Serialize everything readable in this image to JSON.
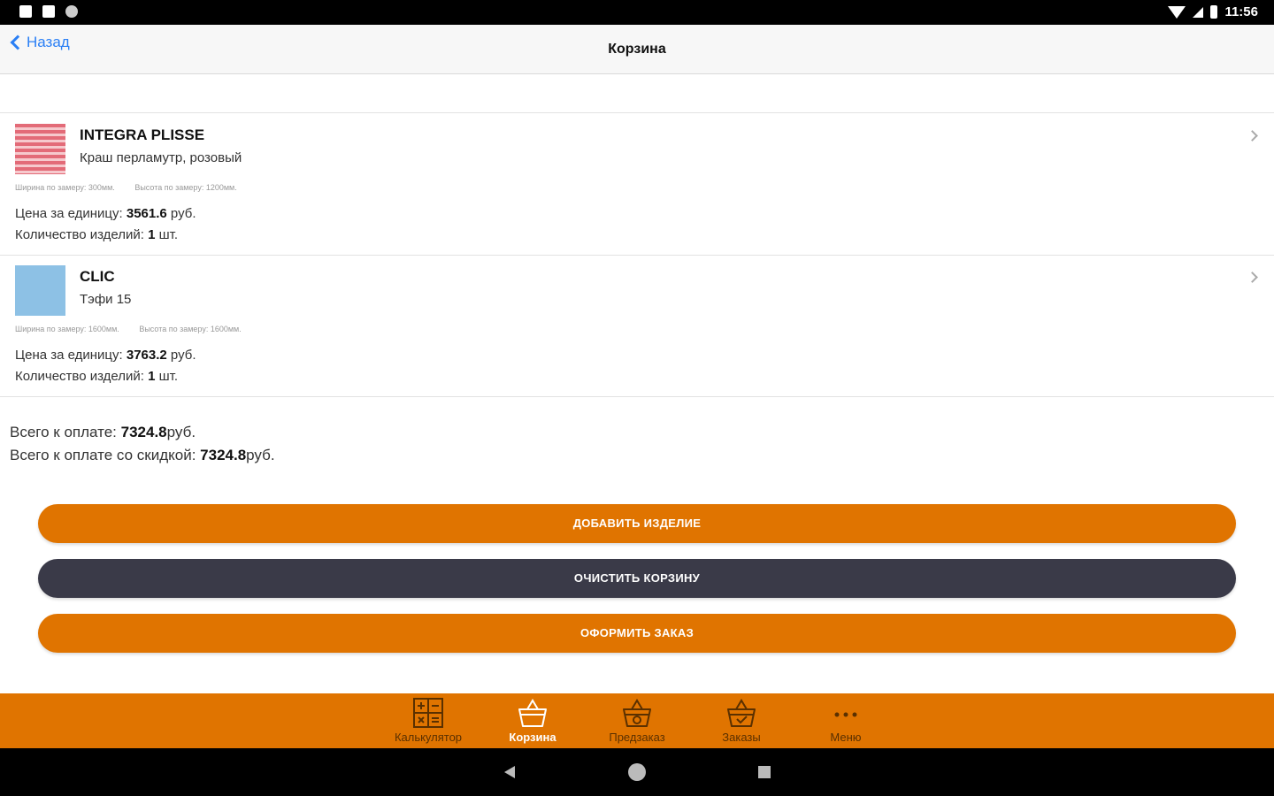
{
  "status_bar": {
    "time": "11:56"
  },
  "nav": {
    "back_label": "Назад",
    "title": "Корзина"
  },
  "cart": {
    "items": [
      {
        "name": "INTEGRA PLISSE",
        "description": "Краш перламутр, розовый",
        "width_text": "Ширина по замеру: 300мм.",
        "height_text": "Высота по замеру: 1200мм.",
        "price_label": "Цена за единицу:",
        "price_value": "3561.6",
        "price_unit": "руб.",
        "qty_label": "Количество изделий:",
        "qty_value": "1",
        "qty_unit": "шт."
      },
      {
        "name": "CLIC",
        "description": "Тэфи 15",
        "width_text": "Ширина по замеру: 1600мм.",
        "height_text": "Высота по замеру: 1600мм.",
        "price_label": "Цена за единицу:",
        "price_value": "3763.2",
        "price_unit": "руб.",
        "qty_label": "Количество изделий:",
        "qty_value": "1",
        "qty_unit": "шт."
      }
    ]
  },
  "totals": {
    "total_label": "Всего к оплате:",
    "total_value": "7324.8",
    "total_unit": "руб.",
    "discount_label": "Всего к оплате со скидкой:",
    "discount_value": "7324.8",
    "discount_unit": "руб."
  },
  "buttons": {
    "add_item": "ДОБАВИТЬ ИЗДЕЛИЕ",
    "clear_cart": "ОЧИСТИТЬ КОРЗИНУ",
    "checkout": "ОФОРМИТЬ ЗАКАЗ"
  },
  "tabs": [
    {
      "label": "Калькулятор",
      "icon": "calculator-icon",
      "active": false
    },
    {
      "label": "Корзина",
      "icon": "basket-icon",
      "active": true
    },
    {
      "label": "Предзаказ",
      "icon": "preorder-basket-icon",
      "active": false
    },
    {
      "label": "Заказы",
      "icon": "orders-basket-icon",
      "active": false
    },
    {
      "label": "Меню",
      "icon": "more-dots-icon",
      "active": false
    }
  ],
  "colors": {
    "accent_orange": "#e07400",
    "dark_button": "#3a3a48",
    "link_blue": "#2a7ff5"
  }
}
